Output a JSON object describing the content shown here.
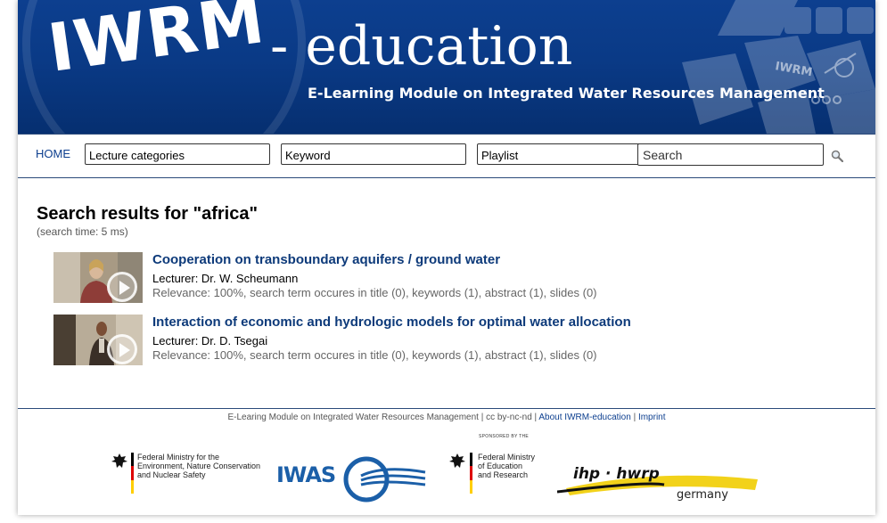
{
  "header": {
    "logo_main": "IWRM",
    "logo_suffix": "- education",
    "subtitle": "E-Learning Module on Integrated Water Resources Management",
    "badge_text": "IWRM"
  },
  "nav": {
    "home": "HOME",
    "lecture_categories": "Lecture categories",
    "keyword": "Keyword",
    "playlist": "Playlist",
    "search_placeholder": "Search"
  },
  "results": {
    "heading": "Search results for \"africa\"",
    "search_time": "(search time: 5 ms)",
    "items": [
      {
        "title": "Cooperation on transboundary aquifers / ground water",
        "lecturer": "Lecturer: Dr. W. Scheumann",
        "relevance": "Relevance: 100%, search term occures in title (0), keywords (1), abstract (1), slides (0)"
      },
      {
        "title": "Interaction of economic and hydrologic models for optimal water allocation",
        "lecturer": "Lecturer: Dr. D. Tsegai",
        "relevance": "Relevance: 100%, search term occures in title (0), keywords (1), abstract (1), slides (0)"
      }
    ]
  },
  "footer": {
    "text": "E-Learing Module on Integrated Water Resources Management | cc by-nc-nd |",
    "about_link": "About IWRM-education",
    "separator": "|",
    "imprint_link": "Imprint",
    "sponsored_by": "SPONSORED BY THE",
    "ministry1": [
      "Federal Ministry for the",
      "Environment, Nature Conservation",
      "and Nuclear Safety"
    ],
    "iwas_logo": "IWAS",
    "ministry2": [
      "Federal Ministry",
      "of Education",
      "and Research"
    ],
    "ihp_logo": "ihp · hwrp",
    "ihp_sub": "germany"
  },
  "colors": {
    "banner_blue": "#0a3a86",
    "link_blue": "#0d3a7a",
    "iwas_blue": "#1b5fa8",
    "ihp_yellow": "#f2d21a"
  }
}
